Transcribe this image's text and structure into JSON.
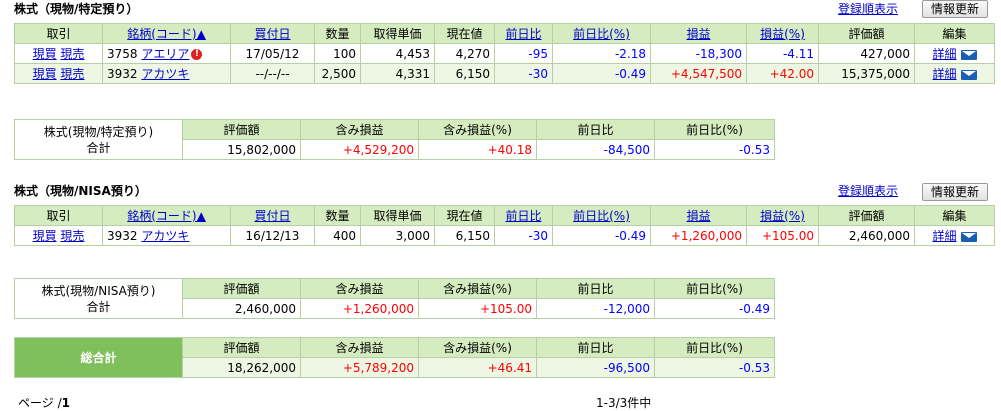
{
  "section1": {
    "title": "株式（現物/特定預り）",
    "sort_link": "登録順表示",
    "refresh": "情報更新",
    "headers": [
      "取引",
      "銘柄(コード)▲",
      "買付日",
      "数量",
      "取得単価",
      "現在値",
      "前日比",
      "前日比(%)",
      "損益",
      "損益(%)",
      "評価額",
      "編集"
    ],
    "rows": [
      {
        "buy": "現買",
        "sell": "現売",
        "code": "3758",
        "name": "アエリア",
        "alert": "!",
        "date": "17/05/12",
        "qty": "100",
        "cost": "4,453",
        "price": "4,270",
        "chg": "-95",
        "chgp": "-2.18",
        "pl": "-18,300",
        "plp": "-4.11",
        "value": "427,000",
        "edit": "詳細"
      },
      {
        "buy": "現買",
        "sell": "現売",
        "code": "3932",
        "name": "アカツキ",
        "alert": "",
        "date": "--/--/--",
        "qty": "2,500",
        "cost": "4,331",
        "price": "6,150",
        "chg": "-30",
        "chgp": "-0.49",
        "pl": "+4,547,500",
        "plp": "+42.00",
        "value": "15,375,000",
        "edit": "詳細"
      }
    ],
    "summary": {
      "label1": "株式(現物/特定預り)",
      "label2": "合計",
      "headers": [
        "評価額",
        "含み損益",
        "含み損益(%)",
        "前日比",
        "前日比(%)"
      ],
      "values": [
        "15,802,000",
        "+4,529,200",
        "+40.18",
        "-84,500",
        "-0.53"
      ]
    }
  },
  "section2": {
    "title": "株式（現物/NISA預り）",
    "sort_link": "登録順表示",
    "refresh": "情報更新",
    "headers": [
      "取引",
      "銘柄(コード)▲",
      "買付日",
      "数量",
      "取得単価",
      "現在値",
      "前日比",
      "前日比(%)",
      "損益",
      "損益(%)",
      "評価額",
      "編集"
    ],
    "rows": [
      {
        "buy": "現買",
        "sell": "現売",
        "code": "3932",
        "name": "アカツキ",
        "alert": "",
        "date": "16/12/13",
        "qty": "400",
        "cost": "3,000",
        "price": "6,150",
        "chg": "-30",
        "chgp": "-0.49",
        "pl": "+1,260,000",
        "plp": "+105.00",
        "value": "2,460,000",
        "edit": "詳細"
      }
    ],
    "summary": {
      "label1": "株式(現物/NISA預り)",
      "label2": "合計",
      "headers": [
        "評価額",
        "含み損益",
        "含み損益(%)",
        "前日比",
        "前日比(%)"
      ],
      "values": [
        "2,460,000",
        "+1,260,000",
        "+105.00",
        "-12,000",
        "-0.49"
      ]
    }
  },
  "total": {
    "label": "総合計",
    "headers": [
      "評価額",
      "含み損益",
      "含み損益(%)",
      "前日比",
      "前日比(%)"
    ],
    "values": [
      "18,262,000",
      "+5,789,200",
      "+46.41",
      "-96,500",
      "-0.53"
    ]
  },
  "footer": {
    "page_label": "ページ /",
    "page_num": "1",
    "count": "1-3/3件中"
  },
  "colors": {
    "header_bg": "#d5ecc0",
    "total_bg": "#7fbf5c",
    "positive": "#ff0000",
    "negative": "#0000ff",
    "link": "#0000cc"
  }
}
